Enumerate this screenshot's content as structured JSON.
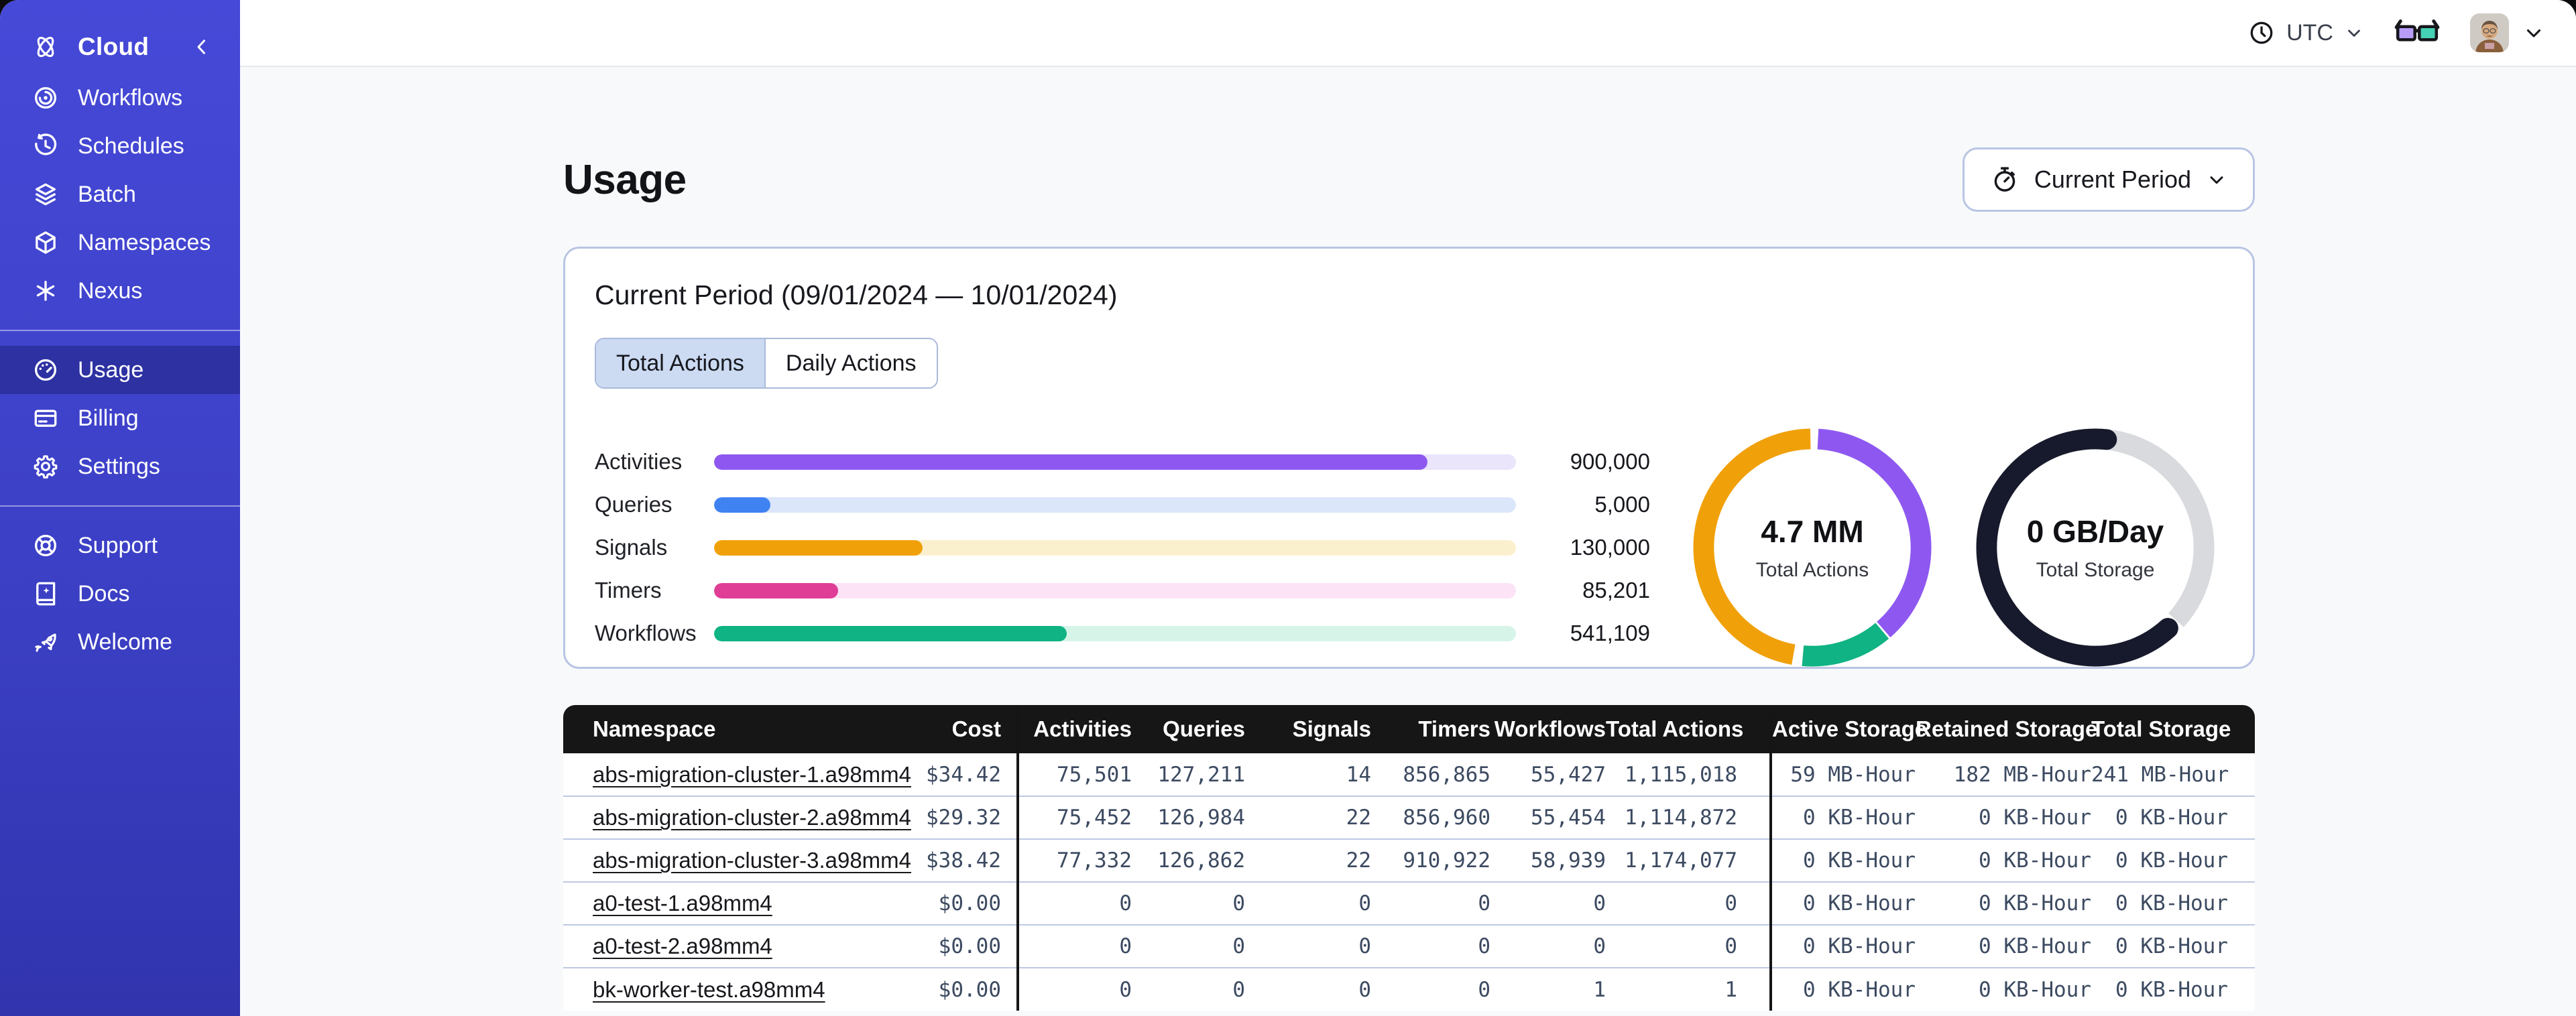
{
  "theme": {
    "sidebar_top": "#4649d7",
    "sidebar_bottom": "#3134ad",
    "page_bg": "#f8f9fb",
    "panel_border": "#b9c5e3",
    "tab_active_bg": "#ccdaf2",
    "table_header_bg": "#161616"
  },
  "sidebar": {
    "brand": "Cloud",
    "main_items": [
      {
        "label": "Workflows",
        "icon": "workflows-icon"
      },
      {
        "label": "Schedules",
        "icon": "schedules-icon"
      },
      {
        "label": "Batch",
        "icon": "batch-icon"
      },
      {
        "label": "Namespaces",
        "icon": "namespaces-icon"
      },
      {
        "label": "Nexus",
        "icon": "nexus-icon"
      }
    ],
    "account_items": [
      {
        "label": "Usage",
        "icon": "usage-gauge-icon",
        "active": true
      },
      {
        "label": "Billing",
        "icon": "billing-card-icon"
      },
      {
        "label": "Settings",
        "icon": "settings-gear-icon"
      }
    ],
    "footer_items": [
      {
        "label": "Support",
        "icon": "support-lifering-icon"
      },
      {
        "label": "Docs",
        "icon": "docs-book-icon"
      },
      {
        "label": "Welcome",
        "icon": "welcome-rocket-icon"
      }
    ]
  },
  "topbar": {
    "timezone": "UTC"
  },
  "page": {
    "title": "Usage"
  },
  "period_selector": {
    "label": "Current Period"
  },
  "usage_panel": {
    "heading": "Current Period (09/01/2024 — 10/01/2024)",
    "tabs": [
      {
        "label": "Total Actions",
        "active": true
      },
      {
        "label": "Daily Actions",
        "active": false
      }
    ],
    "bars": [
      {
        "label": "Activities",
        "value": "900,000",
        "pct": 89,
        "color": "#8e58f0",
        "track": "#eae5fb"
      },
      {
        "label": "Queries",
        "value": "5,000",
        "pct": 7,
        "color": "#3f82f2",
        "track": "#dbe6fb"
      },
      {
        "label": "Signals",
        "value": "130,000",
        "pct": 26,
        "color": "#f0a009",
        "track": "#fbf0ce"
      },
      {
        "label": "Timers",
        "value": "85,201",
        "pct": 15.5,
        "color": "#e03d96",
        "track": "#fce3f5"
      },
      {
        "label": "Workflows",
        "value": "541,109",
        "pct": 44,
        "color": "#10b383",
        "track": "#d6f5e8"
      }
    ],
    "donuts": [
      {
        "value": "4.7 MM",
        "label": "Total Actions",
        "segments": [
          {
            "color": "#8e58f0",
            "start": 3,
            "len": 136
          },
          {
            "color": "#10b383",
            "start": 140,
            "len": 45
          },
          {
            "color": "#f0a009",
            "start": 190,
            "len": 169
          }
        ]
      },
      {
        "value": "0 GB/Day",
        "label": "Total Storage",
        "segments": [
          {
            "color": "#d8dade",
            "start": 6,
            "len": 126
          },
          {
            "color": "#171a2c",
            "start": 138,
            "len": 228,
            "cap": "round"
          }
        ]
      }
    ]
  },
  "table": {
    "columns": [
      "Namespace",
      "Cost",
      "Activities",
      "Queries",
      "Signals",
      "Timers",
      "Workflows",
      "Total Actions",
      "Active Storage",
      "Retained Storage",
      "Total Storage"
    ],
    "rows": [
      [
        "abs-migration-cluster-1.a98mm4",
        "$34.42",
        "75,501",
        "127,211",
        "14",
        "856,865",
        "55,427",
        "1,115,018",
        "59 MB-Hour",
        "182 MB-Hour",
        "241 MB-Hour"
      ],
      [
        "abs-migration-cluster-2.a98mm4",
        "$29.32",
        "75,452",
        "126,984",
        "22",
        "856,960",
        "55,454",
        "1,114,872",
        "0 KB-Hour",
        "0 KB-Hour",
        "0 KB-Hour"
      ],
      [
        "abs-migration-cluster-3.a98mm4",
        "$38.42",
        "77,332",
        "126,862",
        "22",
        "910,922",
        "58,939",
        "1,174,077",
        "0 KB-Hour",
        "0 KB-Hour",
        "0 KB-Hour"
      ],
      [
        "a0-test-1.a98mm4",
        "$0.00",
        "0",
        "0",
        "0",
        "0",
        "0",
        "0",
        "0 KB-Hour",
        "0 KB-Hour",
        "0 KB-Hour"
      ],
      [
        "a0-test-2.a98mm4",
        "$0.00",
        "0",
        "0",
        "0",
        "0",
        "0",
        "0",
        "0 KB-Hour",
        "0 KB-Hour",
        "0 KB-Hour"
      ],
      [
        "bk-worker-test.a98mm4",
        "$0.00",
        "0",
        "0",
        "0",
        "0",
        "1",
        "1",
        "0 KB-Hour",
        "0 KB-Hour",
        "0 KB-Hour"
      ]
    ]
  }
}
